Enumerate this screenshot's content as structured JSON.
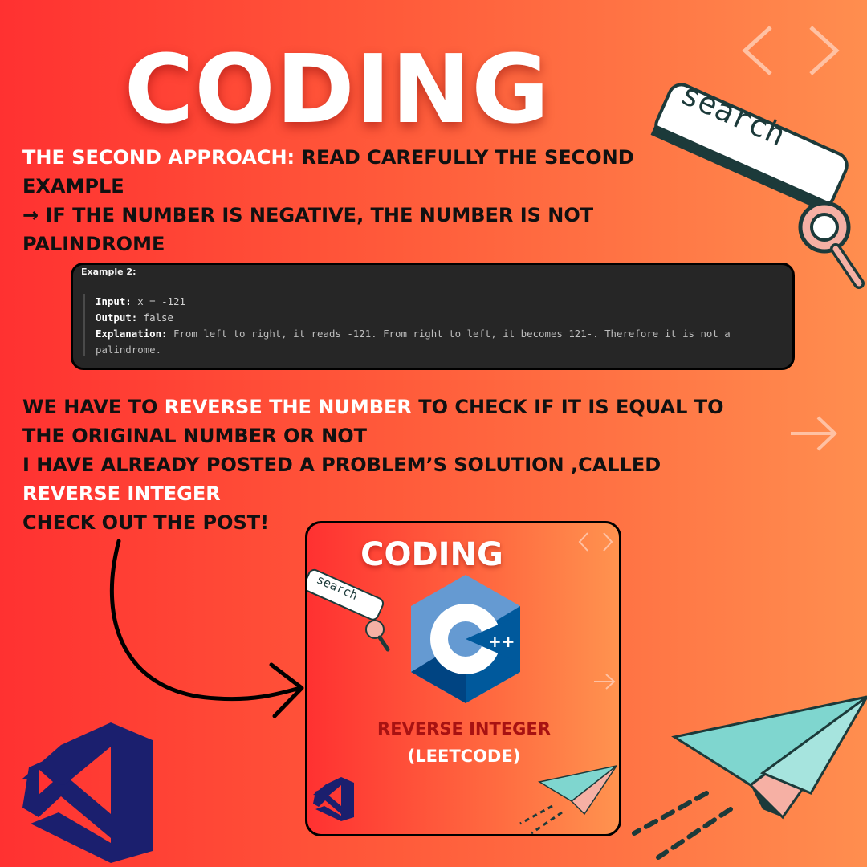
{
  "header": {
    "title": "CODING"
  },
  "intro": {
    "lead": "THE SECOND APPROACH: ",
    "lead_rest": "READ CAREFULLY THE SECOND EXAMPLE",
    "line2": "→ IF THE NUMBER IS NEGATIVE, THE NUMBER IS NOT PALINDROME"
  },
  "example": {
    "heading": "Example 2:",
    "input_label": "Input:",
    "input_value": " x = -121",
    "output_label": "Output:",
    "output_value": " false",
    "explanation_label": "Explanation:",
    "explanation_value": " From left to right, it reads -121. From right to left, it becomes 121-. Therefore it is not a palindrome."
  },
  "body": {
    "p1_a": "WE HAVE TO ",
    "p1_hl": "REVERSE THE NUMBER",
    "p1_b": " TO CHECK IF IT IS EQUAL TO THE ORIGINAL NUMBER OR NOT",
    "p2": "I HAVE ALREADY POSTED A PROBLEM’S SOLUTION ,CALLED",
    "p2_hl": "REVERSE INTEGER",
    "p3": "CHECK OUT THE POST!"
  },
  "search_widget": {
    "label": "search",
    "icon": "magnifier-icon"
  },
  "thumbnail": {
    "title": "CODING",
    "search_label": "search",
    "cpp_logo_text": "C",
    "cpp_plus": "++",
    "subtitle": "REVERSE INTEGER",
    "subtitle2": "(LEETCODE)"
  },
  "colors": {
    "bg_left": "#ff3131",
    "bg_right": "#ff8e4f",
    "code_bg": "#262626",
    "vs_blue": "#1b1f6e",
    "plane_teal": "#7fd6cf",
    "accent_dark_red": "#a81212"
  }
}
